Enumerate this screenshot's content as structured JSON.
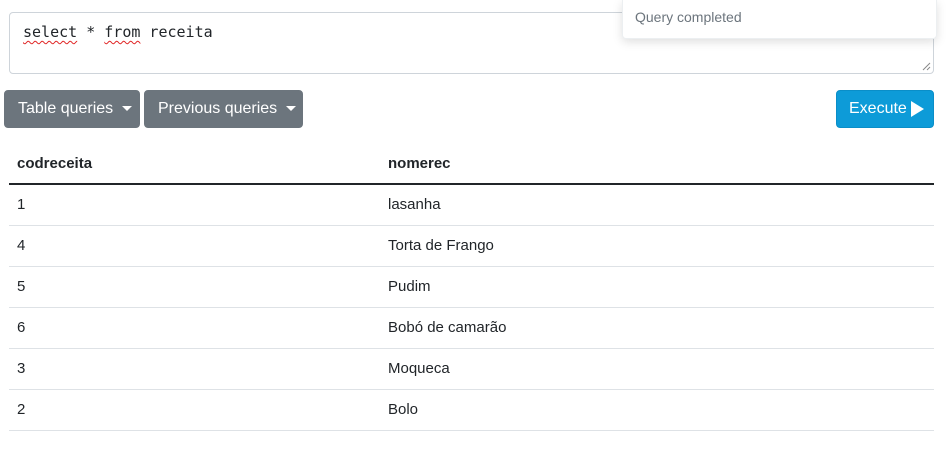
{
  "editor": {
    "keyword_select": "select",
    "middle": " * ",
    "keyword_from": "from",
    "tail": " receita"
  },
  "toast": {
    "message": "Query completed"
  },
  "toolbar": {
    "table_queries_label": "Table queries",
    "previous_queries_label": "Previous queries",
    "execute_label": "Execute",
    "execute_icon": "play-icon",
    "dropdown_icon": "caret-down-icon"
  },
  "results": {
    "columns": [
      "codreceita",
      "nomerec"
    ],
    "rows": [
      [
        "1",
        "lasanha"
      ],
      [
        "4",
        "Torta de Frango"
      ],
      [
        "5",
        "Pudim"
      ],
      [
        "6",
        "Bobó de camarão"
      ],
      [
        "3",
        "Moqueca"
      ],
      [
        "2",
        "Bolo"
      ]
    ]
  },
  "colors": {
    "secondary": "#6c757d",
    "primary": "#0d9bd8",
    "text": "#212529"
  }
}
